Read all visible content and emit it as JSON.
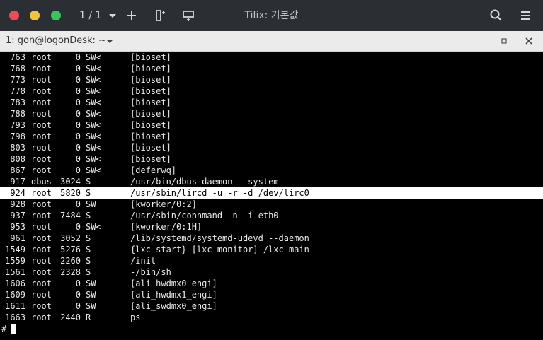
{
  "window": {
    "title": "Tilix: 기본값",
    "session_counter": "1 / 1"
  },
  "tab": {
    "label": "1: gon@logonDesk: ~"
  },
  "colors": {
    "titlebar": "#2b2e33",
    "close": "#ee4c52",
    "minimize": "#f5c33b",
    "maximize": "#35c759",
    "terminal_bg": "#000000",
    "highlight_bg": "#ffffff"
  },
  "terminal": {
    "rows": [
      {
        "pid": "763",
        "user": "root",
        "vsz": "0",
        "stat": "SW<",
        "cmd": "[bioset]"
      },
      {
        "pid": "768",
        "user": "root",
        "vsz": "0",
        "stat": "SW<",
        "cmd": "[bioset]"
      },
      {
        "pid": "773",
        "user": "root",
        "vsz": "0",
        "stat": "SW<",
        "cmd": "[bioset]"
      },
      {
        "pid": "778",
        "user": "root",
        "vsz": "0",
        "stat": "SW<",
        "cmd": "[bioset]"
      },
      {
        "pid": "783",
        "user": "root",
        "vsz": "0",
        "stat": "SW<",
        "cmd": "[bioset]"
      },
      {
        "pid": "788",
        "user": "root",
        "vsz": "0",
        "stat": "SW<",
        "cmd": "[bioset]"
      },
      {
        "pid": "793",
        "user": "root",
        "vsz": "0",
        "stat": "SW<",
        "cmd": "[bioset]"
      },
      {
        "pid": "798",
        "user": "root",
        "vsz": "0",
        "stat": "SW<",
        "cmd": "[bioset]"
      },
      {
        "pid": "803",
        "user": "root",
        "vsz": "0",
        "stat": "SW<",
        "cmd": "[bioset]"
      },
      {
        "pid": "808",
        "user": "root",
        "vsz": "0",
        "stat": "SW<",
        "cmd": "[bioset]"
      },
      {
        "pid": "867",
        "user": "root",
        "vsz": "0",
        "stat": "SW<",
        "cmd": "[deferwq]"
      },
      {
        "pid": "917",
        "user": "dbus",
        "vsz": "3024",
        "stat": "S",
        "cmd": "/usr/bin/dbus-daemon --system"
      },
      {
        "pid": "924",
        "user": "root",
        "vsz": "5820",
        "stat": "S",
        "cmd": "/usr/sbin/lircd -u -r -d /dev/lirc0",
        "highlight": true
      },
      {
        "pid": "928",
        "user": "root",
        "vsz": "0",
        "stat": "SW",
        "cmd": "[kworker/0:2]"
      },
      {
        "pid": "937",
        "user": "root",
        "vsz": "7484",
        "stat": "S",
        "cmd": "/usr/sbin/connmand -n -i eth0"
      },
      {
        "pid": "953",
        "user": "root",
        "vsz": "0",
        "stat": "SW<",
        "cmd": "[kworker/0:1H]"
      },
      {
        "pid": "961",
        "user": "root",
        "vsz": "3052",
        "stat": "S",
        "cmd": "/lib/systemd/systemd-udevd --daemon"
      },
      {
        "pid": "1549",
        "user": "root",
        "vsz": "5276",
        "stat": "S",
        "cmd": "{lxc-start} [lxc monitor] /lxc main"
      },
      {
        "pid": "1559",
        "user": "root",
        "vsz": "2260",
        "stat": "S",
        "cmd": "/init"
      },
      {
        "pid": "1561",
        "user": "root",
        "vsz": "2328",
        "stat": "S",
        "cmd": "-/bin/sh"
      },
      {
        "pid": "1606",
        "user": "root",
        "vsz": "0",
        "stat": "SW",
        "cmd": "[ali_hwdmx0_engi]"
      },
      {
        "pid": "1609",
        "user": "root",
        "vsz": "0",
        "stat": "SW",
        "cmd": "[ali_hwdmx1_engi]"
      },
      {
        "pid": "1611",
        "user": "root",
        "vsz": "0",
        "stat": "SW",
        "cmd": "[ali_swdmx0_engi]"
      },
      {
        "pid": "1663",
        "user": "root",
        "vsz": "2440",
        "stat": "R",
        "cmd": "ps"
      }
    ],
    "prompt": "#"
  }
}
